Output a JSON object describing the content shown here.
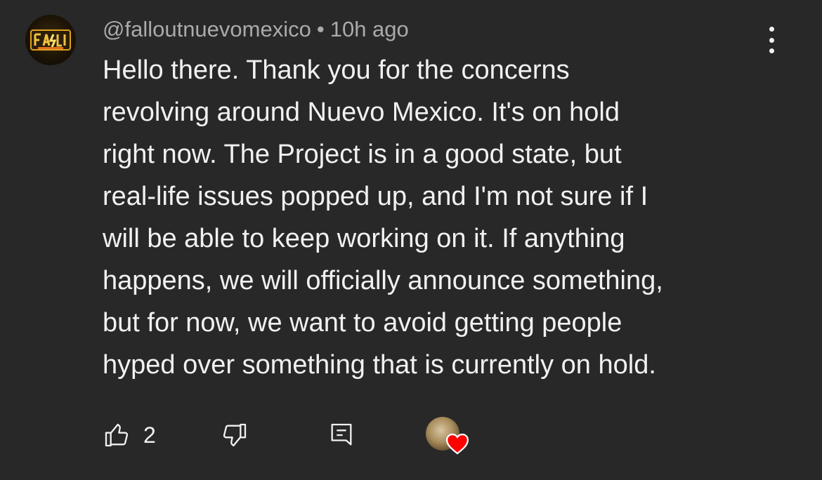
{
  "comment": {
    "author": "@falloutnuevomexico",
    "separator": "•",
    "timestamp": "10h ago",
    "avatar_icon": "channel-logo-icon",
    "menu_icon": "more-vertical-icon",
    "body_lines": [
      "Hello there. Thank you for the concerns",
      "revolving around Nuevo Mexico. It's on hold",
      "right now. The Project is in a good state, but",
      "real-life issues popped up, and I'm not sure if I",
      "will be able to keep working on it. If anything",
      "happens, we will officially announce something,",
      "but for now, we want to avoid getting people",
      "hyped over something that is currently on hold."
    ]
  },
  "actions": {
    "like_icon": "thumbs-up-icon",
    "like_count": "2",
    "dislike_icon": "thumbs-down-icon",
    "reply_icon": "reply-icon",
    "hearted_icon": "creator-heart-icon",
    "heart_color": "#ff0000"
  },
  "colors": {
    "background": "#282828",
    "text_primary": "#f1f1f1",
    "text_secondary": "#aaaaaa"
  }
}
